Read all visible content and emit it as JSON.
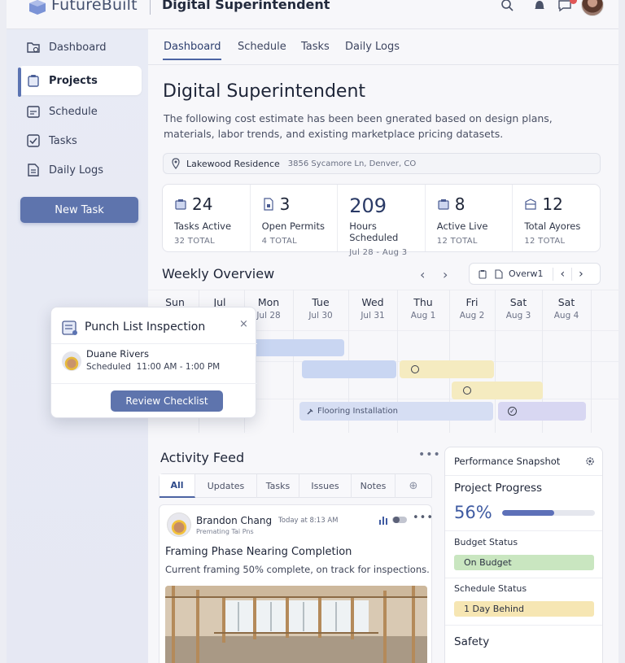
{
  "header": {
    "app_name": "FutureBuilt",
    "page_title": "Digital Superintendent"
  },
  "sidebar": {
    "items": [
      {
        "label": "Dashboard",
        "icon": "folder-icon"
      },
      {
        "label": "Projects",
        "icon": "clipboard-icon",
        "active": true
      },
      {
        "label": "Schedule",
        "icon": "calendar-icon"
      },
      {
        "label": "Tasks",
        "icon": "checkbox-icon"
      },
      {
        "label": "Daily Logs",
        "icon": "document-icon"
      }
    ],
    "new_task_label": "New Task"
  },
  "tabs": [
    "Dashboard",
    "Schedule",
    "Tasks",
    "Daily Logs"
  ],
  "main": {
    "title": "Digital Superintendent",
    "description": "The following cost estimate has been been gnerated based on design plans, materials, labor trends, and existing marketplace pricing datasets.",
    "location": {
      "name": "Lakewood Residence",
      "address": "3856 Sycamore Ln, Denver, CO"
    }
  },
  "stats": [
    {
      "value": "24",
      "label": "Tasks Active",
      "sub": "32  TOTAL",
      "icon": "box-icon"
    },
    {
      "value": "3",
      "label": "Open Permits",
      "sub": "4  TOTAL",
      "icon": "permit-icon"
    },
    {
      "value": "209",
      "label": "Hours Scheduled",
      "sub": "Jul 28 - Aug 3",
      "icon": ""
    },
    {
      "value": "8",
      "label": "Active Live",
      "sub": "12  TOTAL",
      "icon": "box-icon"
    },
    {
      "value": "12",
      "label": "Total Ayores",
      "sub": "12  TOTAL",
      "icon": "archive-icon"
    }
  ],
  "weekly": {
    "title": "Weekly Overview",
    "view_label": "Overw1",
    "days": [
      {
        "name": "Sun",
        "date": ""
      },
      {
        "name": "Jul",
        "date": ""
      },
      {
        "name": "Mon",
        "date": "Jul 28"
      },
      {
        "name": "Tue",
        "date": "Jul 30"
      },
      {
        "name": "Wed",
        "date": "Jul 31"
      },
      {
        "name": "Thu",
        "date": "Aug 1"
      },
      {
        "name": "Fri",
        "date": "Aug 2"
      },
      {
        "name": "Sat",
        "date": "Aug 3"
      },
      {
        "name": "Sat",
        "date": "Aug 4"
      }
    ],
    "bar_label": "Flooring Installation",
    "colors": {
      "blue": "#c9d6f2",
      "yellow": "#f5ebc0",
      "purple": "#d8d7f2"
    }
  },
  "popup": {
    "title": "Punch List Inspection",
    "close": "×",
    "name": "Duane Rivers",
    "status": "Scheduled",
    "time": "11:00 AM - 1:00 PM",
    "button": "Review Checklist"
  },
  "feed": {
    "title": "Activity Feed",
    "menu": "•••",
    "tabs": [
      "All",
      "Updates",
      "Tasks",
      "Issues",
      "Notes"
    ],
    "post": {
      "author": "Brandon Chang",
      "time": "Today at 8:13 AM",
      "subtitle": "Premating  Tai Pns",
      "title": "Framing Phase Nearing Completion",
      "body": "Current framing 50% complete, on track for inspections."
    }
  },
  "performance": {
    "title": "Performance Snapshot",
    "progress_label": "Project Progress",
    "progress_value": "56%",
    "progress_fraction": 0.56,
    "budget_label": "Budget Status",
    "budget_value": "On Budget",
    "schedule_label": "Schedule Status",
    "schedule_value": "1 Day Behind",
    "safety_label": "Safety",
    "colors": {
      "budget": "#c9e6c0",
      "schedule": "#f6e6b3",
      "accent": "#5d70b8"
    }
  }
}
